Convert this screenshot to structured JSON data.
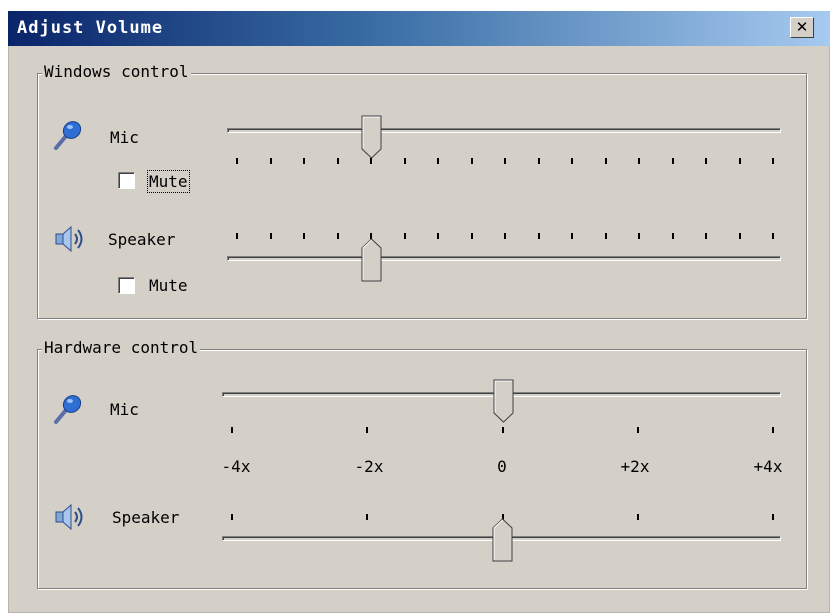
{
  "window": {
    "title": "Adjust Volume",
    "close_glyph": "✕"
  },
  "windows_control": {
    "title": "Windows control",
    "mic": {
      "label": "Mic",
      "mute_label": "Mute",
      "muted": false,
      "level_ticks": 4,
      "tick_count": 17
    },
    "speaker": {
      "label": "Speaker",
      "mute_label": "Mute",
      "muted": false,
      "level_ticks": 4,
      "tick_count": 17
    }
  },
  "hardware_control": {
    "title": "Hardware control",
    "mic": {
      "label": "Mic",
      "value": "0"
    },
    "speaker": {
      "label": "Speaker",
      "value": "0"
    },
    "scale_labels": [
      "-4x",
      "-2x",
      "0",
      "+2x",
      "+4x"
    ]
  },
  "icons": {
    "mic": "microphone-icon",
    "speaker": "speaker-icon"
  },
  "colors": {
    "title_start": "#0a246a",
    "title_end": "#a6caf0",
    "face": "#d4d0c8"
  }
}
